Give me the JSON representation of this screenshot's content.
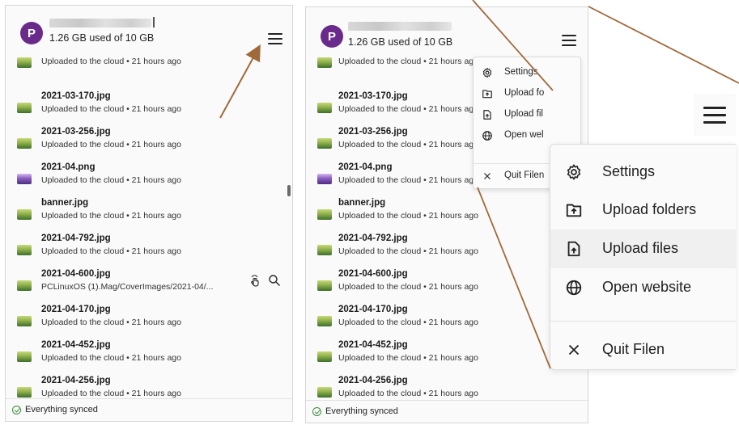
{
  "account": {
    "avatar_letter": "P",
    "storage_text": "1.26 GB used of 10 GB"
  },
  "files": [
    {
      "name": "",
      "status": "Uploaded to the cloud  •  21 hours ago",
      "thumb": "green",
      "partial": true
    },
    {
      "name": "2021-03-170.jpg",
      "status": "Uploaded to the cloud  •  21 hours ago",
      "thumb": "green"
    },
    {
      "name": "2021-03-256.jpg",
      "status": "Uploaded to the cloud  •  21 hours ago",
      "thumb": "green"
    },
    {
      "name": "2021-04.png",
      "status": "Uploaded to the cloud  •  21 hours ago",
      "thumb": "purple"
    },
    {
      "name": "banner.jpg",
      "status": "Uploaded to the cloud  •  21 hours ago",
      "thumb": "green"
    },
    {
      "name": "2021-04-792.jpg",
      "status": "Uploaded to the cloud  •  21 hours ago",
      "thumb": "green"
    },
    {
      "name": "2021-04-600.jpg",
      "status": "Uploaded to the cloud  •  21 hours ago",
      "thumb": "green"
    },
    {
      "name": "2021-04-170.jpg",
      "status": "Uploaded to the cloud  •  21 hours ago",
      "thumb": "green"
    },
    {
      "name": "2021-04-452.jpg",
      "status": "Uploaded to the cloud  •  21 hours ago",
      "thumb": "green"
    },
    {
      "name": "2021-04-256.jpg",
      "status": "Uploaded to the cloud  •  21 hours ago",
      "thumb": "green"
    }
  ],
  "hovered_row_path": "PCLinuxOS (1).Mag/CoverImages/2021-04/...",
  "status_bar": {
    "text": "Everything synced"
  },
  "menu_small": [
    {
      "label": "Settings",
      "icon": "gear-icon"
    },
    {
      "label": "Upload fo",
      "icon": "folder-upload-icon"
    },
    {
      "label": "Upload fil",
      "icon": "file-upload-icon"
    },
    {
      "label": "Open wel",
      "icon": "globe-icon"
    },
    {
      "label": "Quit Filen",
      "icon": "close-icon"
    }
  ],
  "menu_zoom": [
    {
      "label": "Settings",
      "icon": "gear-icon"
    },
    {
      "label": "Upload folders",
      "icon": "folder-upload-icon"
    },
    {
      "label": "Upload files",
      "icon": "file-upload-icon"
    },
    {
      "label": "Open website",
      "icon": "globe-icon"
    },
    {
      "label": "Quit Filen",
      "icon": "close-icon"
    }
  ],
  "colors": {
    "avatar": "#6a2a8c",
    "arrow": "#a0693a",
    "synced": "#3a8a3a"
  }
}
